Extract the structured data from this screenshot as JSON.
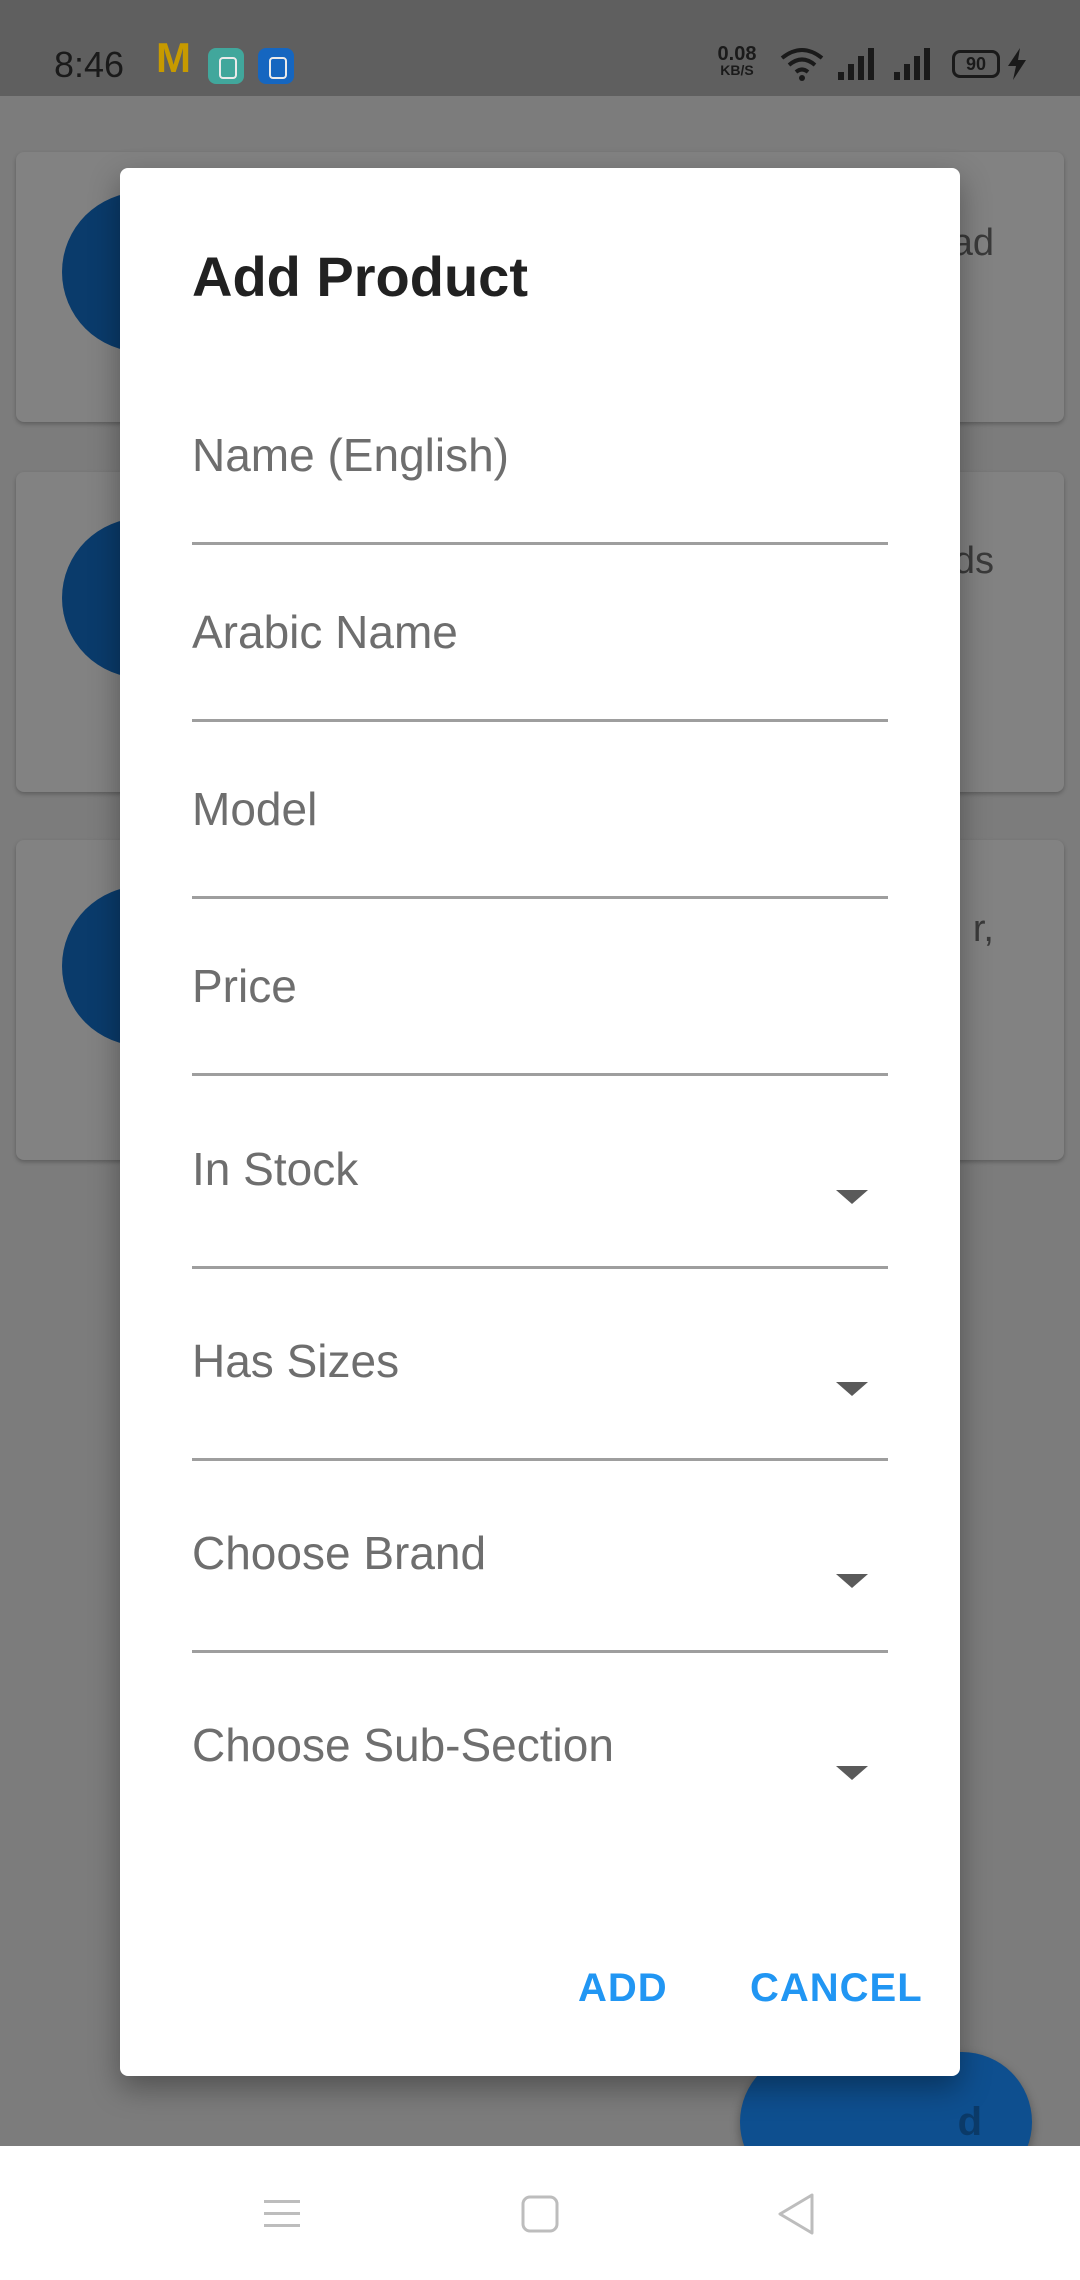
{
  "status_bar": {
    "time": "8:46",
    "network_speed_value": "0.08",
    "network_speed_unit": "KB/S",
    "battery_level": "90",
    "icons": [
      "mcdonalds-icon",
      "app-icon",
      "usb-icon",
      "wifi-icon",
      "signal-icon",
      "signal-icon",
      "battery-icon",
      "charging-icon"
    ]
  },
  "background": {
    "card_texts": [
      "ad",
      "fds",
      "r,"
    ],
    "fab_label": "d"
  },
  "dialog": {
    "title": "Add Product",
    "fields": [
      {
        "label": "Name (English)",
        "type": "text"
      },
      {
        "label": "Arabic Name",
        "type": "text"
      },
      {
        "label": "Model",
        "type": "text"
      },
      {
        "label": "Price",
        "type": "text"
      },
      {
        "label": "In Stock",
        "type": "dropdown"
      },
      {
        "label": "Has Sizes",
        "type": "dropdown"
      },
      {
        "label": "Choose Brand",
        "type": "dropdown"
      },
      {
        "label": "Choose Sub-Section",
        "type": "dropdown"
      }
    ],
    "actions": {
      "add_label": "ADD",
      "cancel_label": "CANCEL"
    },
    "accent_color": "#2196f3"
  },
  "nav_bar": {
    "icons": [
      "menu-icon",
      "home-icon",
      "back-icon"
    ]
  }
}
